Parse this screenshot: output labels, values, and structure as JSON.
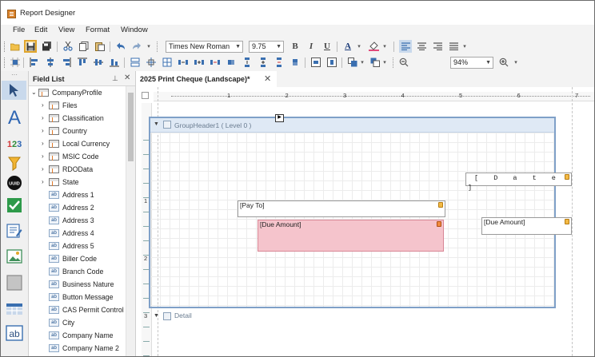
{
  "window": {
    "title": "Report Designer"
  },
  "menu": [
    "File",
    "Edit",
    "View",
    "Format",
    "Window"
  ],
  "toolbar": {
    "font_name": "Times New Roman",
    "font_size": "9.75",
    "bold": "B",
    "italic": "I",
    "underline": "U",
    "font_color_letter": "A",
    "zoom": "94%"
  },
  "field_list": {
    "title": "Field List",
    "items": [
      {
        "label": "CompanyProfile",
        "kind": "table",
        "level": 0,
        "expanded": true
      },
      {
        "label": "Files",
        "kind": "table",
        "level": 1
      },
      {
        "label": "Classification",
        "kind": "table",
        "level": 1
      },
      {
        "label": "Country",
        "kind": "table",
        "level": 1
      },
      {
        "label": "Local Currency",
        "kind": "table",
        "level": 1
      },
      {
        "label": "MSIC Code",
        "kind": "table",
        "level": 1
      },
      {
        "label": "RDOData",
        "kind": "table",
        "level": 1
      },
      {
        "label": "State",
        "kind": "table",
        "level": 1
      },
      {
        "label": "Address 1",
        "kind": "field",
        "level": 1
      },
      {
        "label": "Address 2",
        "kind": "field",
        "level": 1
      },
      {
        "label": "Address 3",
        "kind": "field",
        "level": 1
      },
      {
        "label": "Address 4",
        "kind": "field",
        "level": 1
      },
      {
        "label": "Address 5",
        "kind": "field",
        "level": 1
      },
      {
        "label": "Biller Code",
        "kind": "field",
        "level": 1
      },
      {
        "label": "Branch Code",
        "kind": "field",
        "level": 1
      },
      {
        "label": "Business Nature",
        "kind": "field",
        "level": 1
      },
      {
        "label": "Button Message",
        "kind": "field",
        "level": 1
      },
      {
        "label": "CAS Permit Control N",
        "kind": "field",
        "level": 1
      },
      {
        "label": "City",
        "kind": "field",
        "level": 1
      },
      {
        "label": "Company Name",
        "kind": "field",
        "level": 1
      },
      {
        "label": "Company Name 2",
        "kind": "field",
        "level": 1
      }
    ]
  },
  "document": {
    "tab_label": "2025 Print Cheque (Landscape)*",
    "ruler_h": [
      "1",
      "2",
      "3",
      "4",
      "5",
      "6",
      "7"
    ],
    "ruler_v": [
      "1",
      "2",
      "3"
    ],
    "group_header_label": "GroupHeader1 ( Level 0 )",
    "detail_label": "Detail",
    "controls": {
      "date": "[ D a t e ]",
      "pay_to": "[Pay To]",
      "amount": "[Due Amount]",
      "due_amount": "[Due Amount]"
    }
  },
  "icons": {
    "field_badge": "ab",
    "toolbox": [
      "pointer-icon",
      "label-icon",
      "number-icon",
      "filter-icon",
      "uuid-icon",
      "checkbox-icon",
      "richtext-icon",
      "picture-icon",
      "panel-icon",
      "table-icon",
      "textbox-icon"
    ]
  },
  "colors": {
    "accent_blue": "#3a6fb0",
    "band_border": "#7fa0c8",
    "selected_control": "#f5c4cc",
    "save_highlight": "#e0a52c"
  }
}
